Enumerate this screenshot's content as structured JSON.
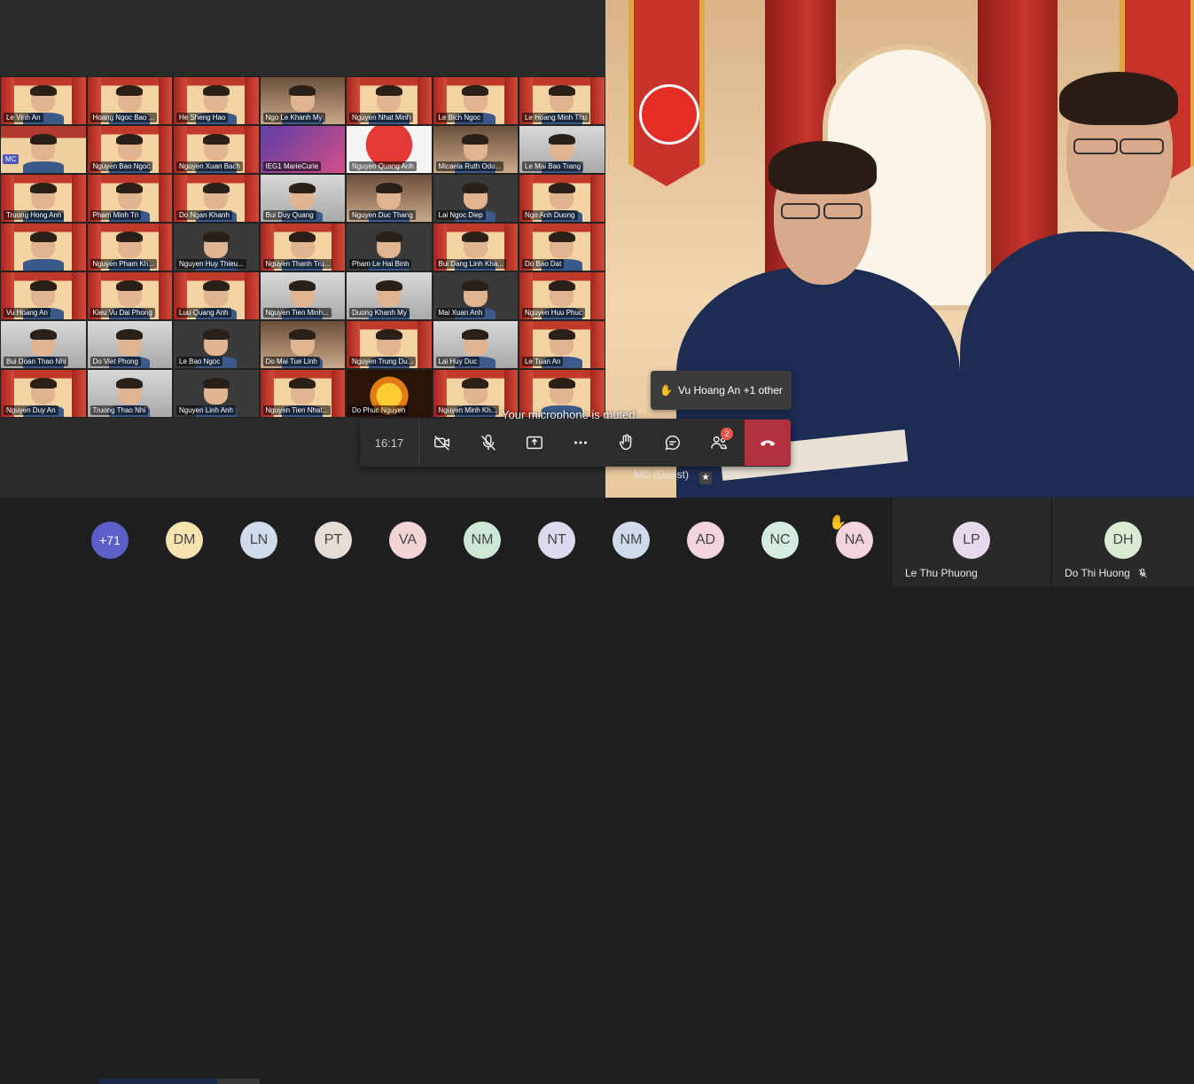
{
  "gallery": {
    "tiles": [
      {
        "name": "Le Vinh An",
        "style": ""
      },
      {
        "name": "Hoang Ngoc Bao ...",
        "style": ""
      },
      {
        "name": "He Sheng Hao",
        "style": ""
      },
      {
        "name": "Ngo Le Khanh My",
        "style": "room"
      },
      {
        "name": "Nguyen Nhat Minh",
        "style": ""
      },
      {
        "name": "Le Bich Ngoc",
        "style": ""
      },
      {
        "name": "Le Hoang Minh Thu",
        "style": ""
      },
      {
        "name": "MC",
        "style": "mc"
      },
      {
        "name": "Nguyen Bao Ngoc",
        "style": ""
      },
      {
        "name": "Nguyen Xuan Bach",
        "style": ""
      },
      {
        "name": "IEG1 MarieCurie",
        "style": "blue"
      },
      {
        "name": "Nguyen Quang Anh",
        "style": "red"
      },
      {
        "name": "Micaela Ruth Odo...",
        "style": "room"
      },
      {
        "name": "Le Mai Bao Trang",
        "style": "gray"
      },
      {
        "name": "Truong Hong Anh",
        "style": ""
      },
      {
        "name": "Pham Minh Tri",
        "style": ""
      },
      {
        "name": "Do Ngan Khanh",
        "style": ""
      },
      {
        "name": "Bui Duy Quang",
        "style": "gray"
      },
      {
        "name": "Nguyen Duc Thang",
        "style": "room"
      },
      {
        "name": "Lai Ngoc Diep",
        "style": "dark"
      },
      {
        "name": "Ngo Anh Duong",
        "style": ""
      },
      {
        "name": "",
        "style": ""
      },
      {
        "name": "Nguyen Pham Kh...",
        "style": ""
      },
      {
        "name": "Nguyen Huy Thieu...",
        "style": "dark"
      },
      {
        "name": "Nguyen Thanh Tru...",
        "style": ""
      },
      {
        "name": "Pham Le Hai Binh",
        "style": "dark"
      },
      {
        "name": "Bui Dang Linh Kha...",
        "style": ""
      },
      {
        "name": "Do Bao Dat",
        "style": ""
      },
      {
        "name": "Vu Hoang An",
        "style": ""
      },
      {
        "name": "Kieu Vu Dai Phong",
        "style": ""
      },
      {
        "name": "Luu Quang Anh",
        "style": ""
      },
      {
        "name": "Nguyen Tien Minh...",
        "style": "gray"
      },
      {
        "name": "Duong Khanh My",
        "style": "gray"
      },
      {
        "name": "Mai Xuan Anh",
        "style": "dark"
      },
      {
        "name": "Nguyen Huu Phuc",
        "style": ""
      },
      {
        "name": "Bui Doan Thao Nhi",
        "style": "gray"
      },
      {
        "name": "Do Viet Phong",
        "style": "gray"
      },
      {
        "name": "Le Bao Ngoc",
        "style": "dark"
      },
      {
        "name": "Do Mai Tue Linh",
        "style": "room"
      },
      {
        "name": "Nguyen Trung Du...",
        "style": ""
      },
      {
        "name": "Lai Huy Duc",
        "style": "gray"
      },
      {
        "name": "Le Tuan An",
        "style": ""
      },
      {
        "name": "Nguyen Duy An",
        "style": ""
      },
      {
        "name": "Truong Thao Nhi",
        "style": "gray"
      },
      {
        "name": "Nguyen Linh Anh",
        "style": "dark"
      },
      {
        "name": "Nguyen Tien Nhat...",
        "style": ""
      },
      {
        "name": "Do Phuc Nguyen",
        "style": "sun"
      },
      {
        "name": "Nguyen Minh Kh...",
        "style": ""
      },
      {
        "name": "",
        "style": ""
      }
    ]
  },
  "spotlight": {
    "name": "MC (Guest)"
  },
  "notifications": {
    "raised_hands": "Vu Hoang An +1 other",
    "muted": "Your microphone is muted."
  },
  "controls": {
    "timer": "16:17",
    "participants_badge": "2"
  },
  "strip": {
    "more": "+71",
    "avatars": [
      {
        "initials": "DM",
        "bg": "#f7e3b0"
      },
      {
        "initials": "LN",
        "bg": "#cfdbeb"
      },
      {
        "initials": "PT",
        "bg": "#e5ddd5"
      },
      {
        "initials": "VA",
        "bg": "#f2d4d7"
      },
      {
        "initials": "NM",
        "bg": "#cde8d6"
      },
      {
        "initials": "NT",
        "bg": "#dcd8ef"
      },
      {
        "initials": "NM",
        "bg": "#cfdbeb"
      },
      {
        "initials": "AD",
        "bg": "#f2d4de"
      },
      {
        "initials": "NC",
        "bg": "#d4ece0"
      },
      {
        "initials": "NA",
        "bg": "#f2d4de"
      }
    ],
    "tiles": [
      {
        "initials": "LP",
        "bg": "#e8d8ec",
        "name": "Le Thu Phuong"
      },
      {
        "initials": "DH",
        "bg": "#dbead3",
        "name": "Do Thi Huong"
      }
    ]
  },
  "colors": {
    "leave": "#b23141",
    "more_avatar": "#5b5fc7",
    "badge": "#e4564a"
  }
}
